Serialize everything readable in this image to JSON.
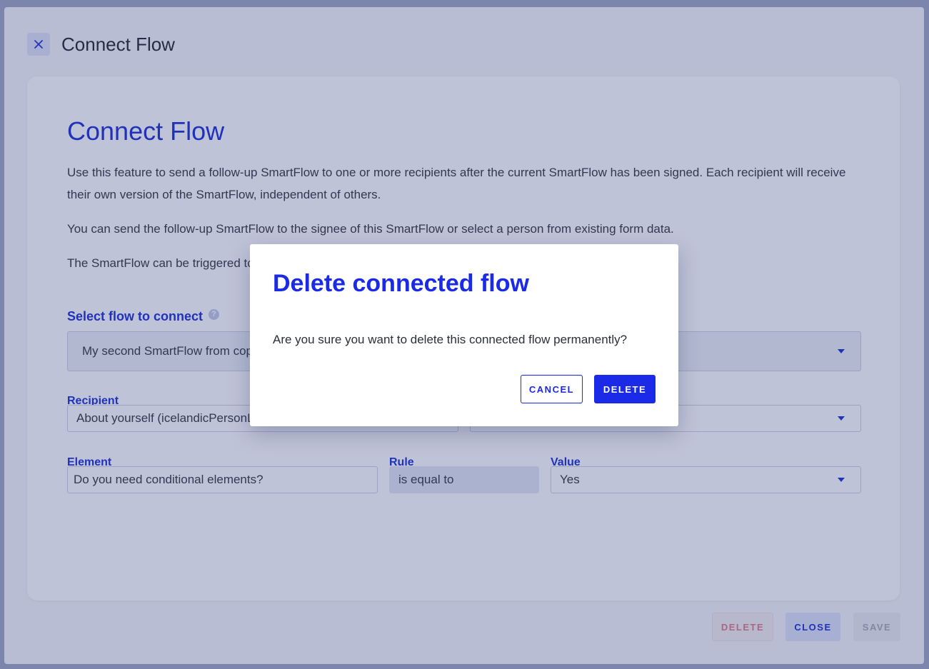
{
  "header": {
    "title": "Connect Flow"
  },
  "panel": {
    "heading": "Connect Flow",
    "paragraphs": [
      "Use this feature to send a follow-up SmartFlow to one or more recipients after the current SmartFlow has been signed. Each recipient will receive their own version of the SmartFlow, independent of others.",
      "You can send the follow-up SmartFlow to the signee of this SmartFlow or select a person from existing form data.",
      "The SmartFlow can be triggered to"
    ],
    "select_flow": {
      "label": "Select flow to connect",
      "value": "My second SmartFlow from cop"
    },
    "recipient": {
      "label": "Recipient",
      "value": "About yourself (icelandicPersonL"
    },
    "element": {
      "label": "Element",
      "value": "Do you need conditional elements?"
    },
    "rule": {
      "label": "Rule",
      "value": "is equal to"
    },
    "value": {
      "label": "Value",
      "value": "Yes"
    }
  },
  "footer": {
    "delete_label": "DELETE",
    "close_label": "CLOSE",
    "save_label": "SAVE"
  },
  "modal": {
    "title": "Delete connected flow",
    "message": "Are you sure you want to delete this connected flow permanently?",
    "cancel_label": "CANCEL",
    "delete_label": "DELETE"
  },
  "colors": {
    "accent": "#1a2ae6",
    "heading": "#2336d6",
    "danger_muted": "#e37d8e"
  },
  "icons": {
    "close": "close-icon",
    "help": "help-icon",
    "caret": "chevron-down-icon"
  }
}
